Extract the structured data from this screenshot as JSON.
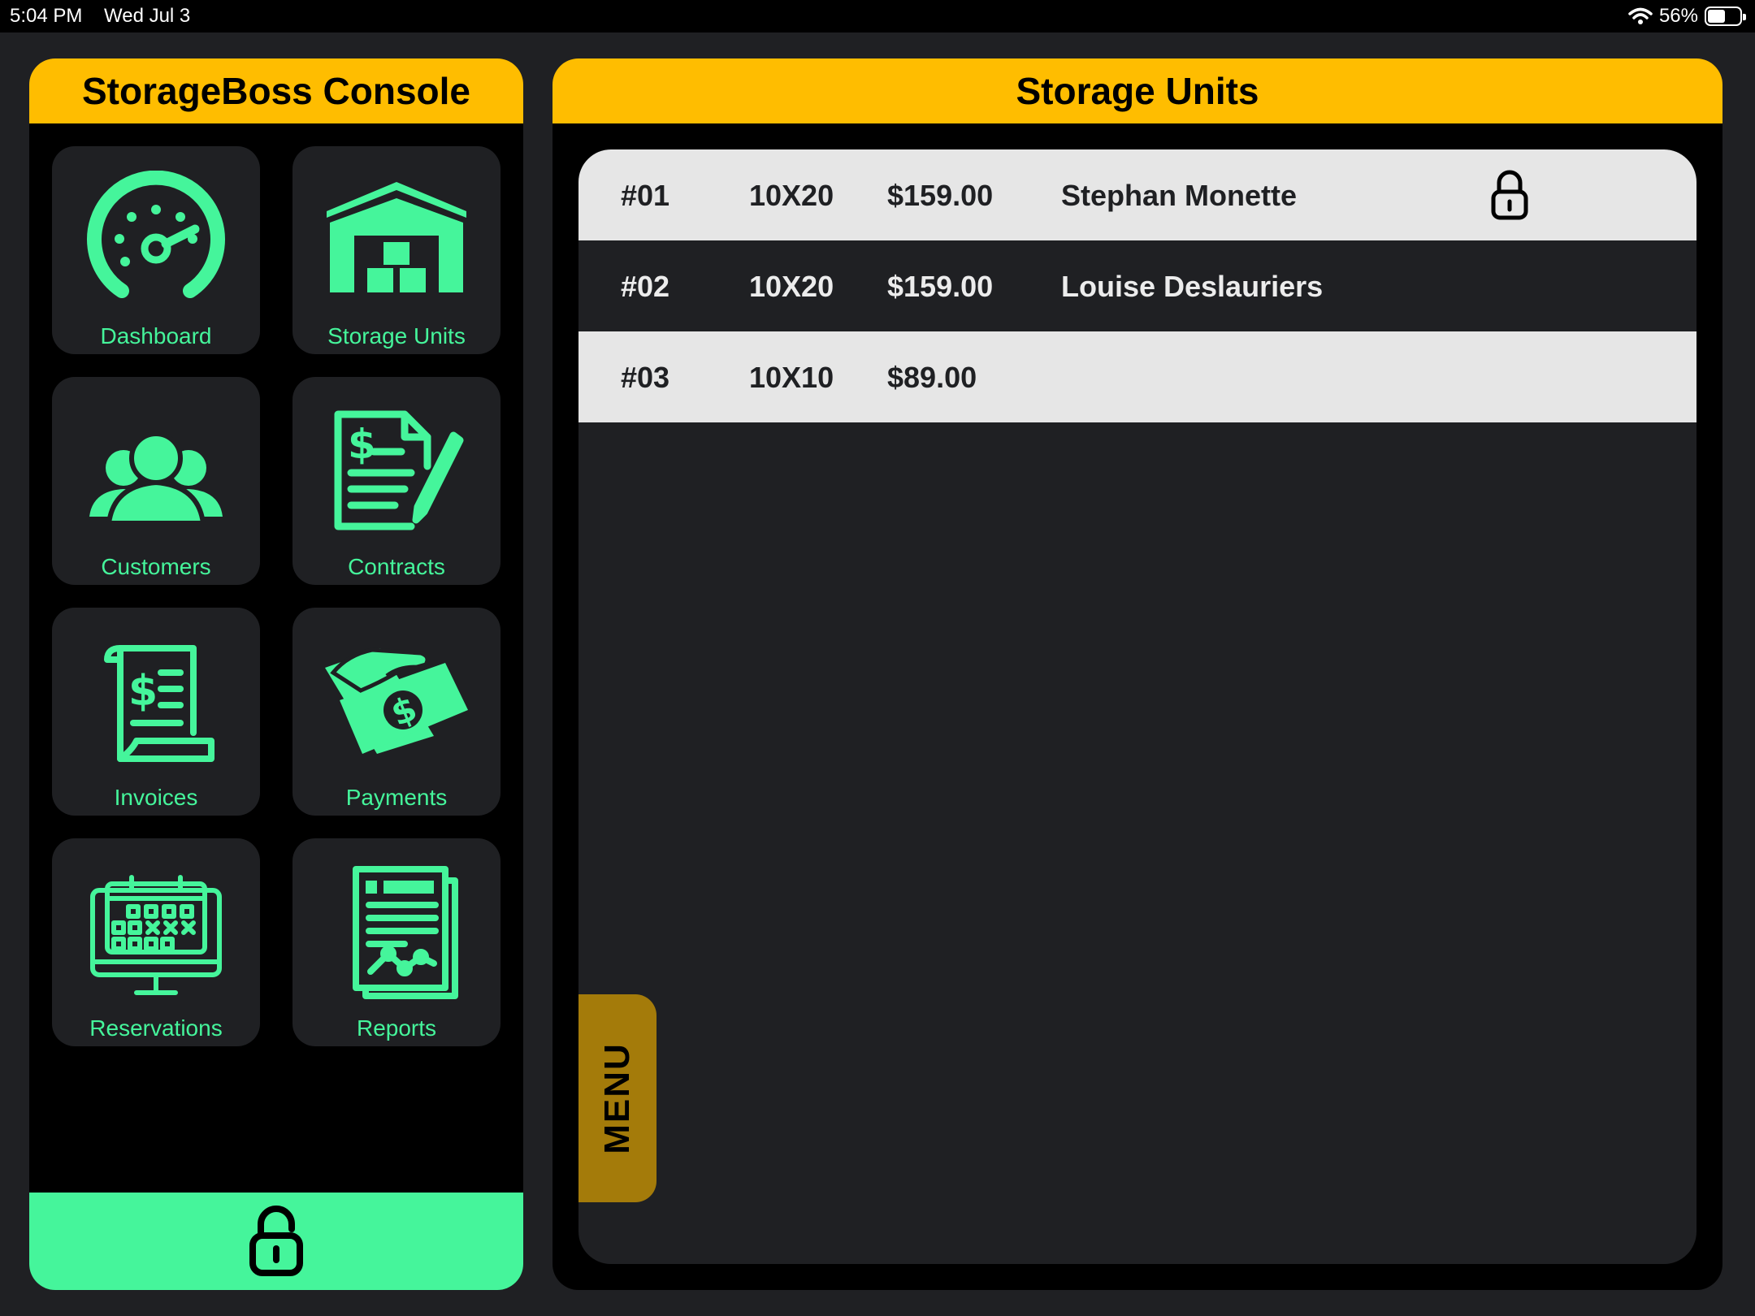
{
  "status_bar": {
    "time": "5:04 PM",
    "date": "Wed Jul 3",
    "battery": "56%",
    "battery_level": 0.56
  },
  "console": {
    "title": "StorageBoss Console",
    "tiles": [
      {
        "label": "Dashboard",
        "icon": "speedometer-icon"
      },
      {
        "label": "Storage Units",
        "icon": "warehouse-icon"
      },
      {
        "label": "Customers",
        "icon": "users-group-icon"
      },
      {
        "label": "Contracts",
        "icon": "contract-pen-icon"
      },
      {
        "label": "Invoices",
        "icon": "invoice-receipt-icon"
      },
      {
        "label": "Payments",
        "icon": "hand-money-icon"
      },
      {
        "label": "Reservations",
        "icon": "calendar-monitor-icon"
      },
      {
        "label": "Reports",
        "icon": "report-documents-icon"
      }
    ],
    "lock_icon": "unlock-icon"
  },
  "units": {
    "title": "Storage Units",
    "rows": [
      {
        "number": "#01",
        "size": "10X20",
        "price": "$159.00",
        "customer": "Stephan Monette",
        "locked": true
      },
      {
        "number": "#02",
        "size": "10X20",
        "price": "$159.00",
        "customer": "Louise Deslauriers",
        "locked": false
      },
      {
        "number": "#03",
        "size": "10X10",
        "price": "$89.00",
        "customer": "",
        "locked": false
      }
    ],
    "menu_label": "MENU"
  },
  "colors": {
    "accent_yellow": "#ffbd00",
    "accent_green": "#45f59b",
    "menu_tab": "#a47b0a",
    "panel_bg": "#1f2023"
  }
}
